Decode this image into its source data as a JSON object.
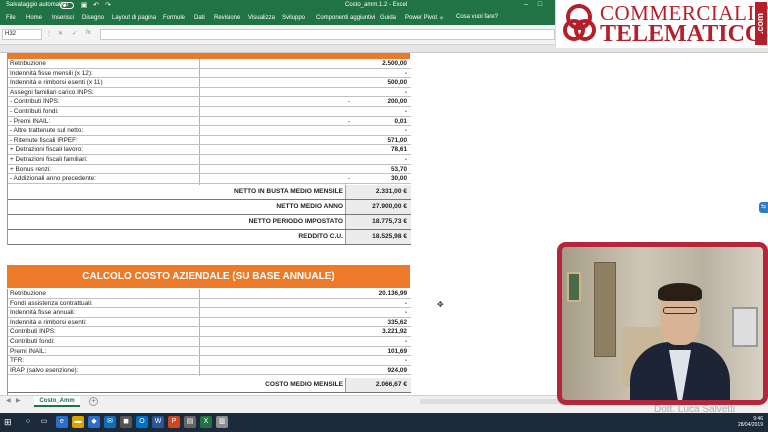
{
  "titlebar": {
    "autosave_label": "Salvataggio automatico",
    "doc_title": "Costo_amm.1.2  -  Excel",
    "min": "–",
    "max": "□",
    "close": "✕"
  },
  "menu": {
    "items": [
      "File",
      "Home",
      "Inserisci",
      "Disegno",
      "Layout di pagina",
      "Formule",
      "Dati",
      "Revisione",
      "Visualizza",
      "Sviluppo",
      "Componenti aggiuntivi",
      "Guida",
      "Power Pivot"
    ],
    "tell_me": "Cosa vuoi fare?"
  },
  "formula": {
    "namebox": "H32",
    "fx_label": "fx",
    "value": ""
  },
  "logo": {
    "line1": "COMMERCIALISTA",
    "line2": "TELEMATICO",
    "suffix": ".com"
  },
  "table1": {
    "rows": [
      {
        "label": "Retribuzione",
        "dash": "",
        "value": "2.500,00"
      },
      {
        "label": "Indennità fisse  mensili (x 12):",
        "dash": "",
        "value": "-"
      },
      {
        "label": "Indennità e rimborsi esenti (x 11)",
        "dash": "",
        "value": "500,00"
      },
      {
        "label": "Assegni familiari carico INPS:",
        "dash": "",
        "value": "-"
      },
      {
        "label": " - Contributi INPS:",
        "dash": "-",
        "value": "200,00"
      },
      {
        "label": " - Contributi fondi:",
        "dash": "",
        "value": "-"
      },
      {
        "label": " - Premi INAIL:",
        "dash": "-",
        "value": "0,01"
      },
      {
        "label": " - Altre trattenute sul netto:",
        "dash": "",
        "value": "-"
      },
      {
        "label": " - Ritenute fiscali IRPEF:",
        "dash": "",
        "value": "571,00"
      },
      {
        "label": " + Detrazioni fiscali lavoro:",
        "dash": "",
        "value": "78,61"
      },
      {
        "label": " + Detrazioni fiscali familiari:",
        "dash": "",
        "value": "-"
      },
      {
        "label": " + Bonus renzi:",
        "dash": "",
        "value": "53,70"
      },
      {
        "label": " - Addizionali anno precedente:",
        "dash": "-",
        "value": "30,00"
      }
    ],
    "totals": [
      {
        "label": "NETTO IN BUSTA MEDIO MENSILE",
        "value": "2.331,00 €"
      },
      {
        "label": "NETTO MEDIO ANNO",
        "value": "27.900,00 €"
      },
      {
        "label": "NETTO PERIODO IMPOSTATO",
        "value": "18.775,73 €"
      },
      {
        "label": "REDDITO C.U.",
        "value": "18.525,98 €"
      }
    ]
  },
  "table2": {
    "title": "CALCOLO COSTO AZIENDALE (SU BASE ANNUALE)",
    "rows": [
      {
        "label": "Retribuzione",
        "value": "20.136,99"
      },
      {
        "label": "Fondi assistenza contrattuali:",
        "value": "-"
      },
      {
        "label": "Indennità fisse annuali:",
        "value": "-"
      },
      {
        "label": "Indennità e rimborsi esenti:",
        "value": "335,62"
      },
      {
        "label": "Contributi INPS:",
        "value": "3.221,92"
      },
      {
        "label": "Contributi fondi:",
        "value": "-"
      },
      {
        "label": "Premi INAIL:",
        "value": "101,69"
      },
      {
        "label": "TFR:",
        "value": "-"
      },
      {
        "label": "IRAP (salvo esenzione):",
        "value": "924,09"
      }
    ],
    "total": {
      "label": "COSTO  MEDIO MENSILE",
      "value": "2.066,67 €"
    }
  },
  "sheet_tabs": {
    "active": "Costo_Amm",
    "add": "+"
  },
  "webcam": {
    "name": "Dott. Luca Salvetti"
  },
  "taskbar": {
    "time": "9:46",
    "date": "28/04/2019"
  },
  "colors": {
    "excel_green": "#217346",
    "orange": "#ec7a28",
    "logo_red": "#b41f2a",
    "frame_red": "#b3263b"
  }
}
